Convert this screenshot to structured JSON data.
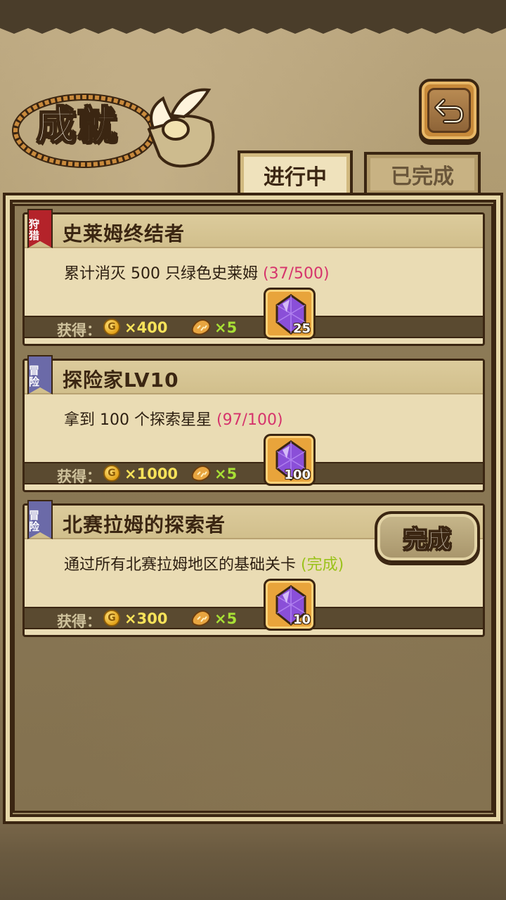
{
  "header": {
    "title": "成就",
    "back_icon": "return-arrow-icon"
  },
  "tabs": [
    {
      "label": "进行中",
      "active": true
    },
    {
      "label": "已完成",
      "active": false
    }
  ],
  "achievements": [
    {
      "tag": "狩猎",
      "tag_color": "#b4232a",
      "title": "史莱姆终结者",
      "description": "累计消灭 500 只绿色史莱姆",
      "progress": "(37/500)",
      "reward_label": "获得：",
      "gold": "×400",
      "bread": "×5",
      "gem_count": "25",
      "completed": false
    },
    {
      "tag": "冒险",
      "tag_color": "#6b6aa8",
      "title": "探险家LV10",
      "description": "拿到 100 个探索星星",
      "progress": "(97/100)",
      "reward_label": "获得：",
      "gold": "×1000",
      "bread": "×5",
      "gem_count": "100",
      "completed": false
    },
    {
      "tag": "冒险",
      "tag_color": "#6b6aa8",
      "title": "北赛拉姆的探索者",
      "description": "通过所有北赛拉姆地区的基础关卡",
      "progress": "(完成)",
      "reward_label": "获得：",
      "gold": "×300",
      "bread": "×5",
      "gem_count": "10",
      "completed": true,
      "complete_button": "完成"
    }
  ],
  "coin_symbol": "G",
  "colors": {
    "progress_in_progress": "#d6336c",
    "progress_done": "#9ac21a",
    "gold_text": "#f7e35a",
    "bread_text": "#a8e035"
  }
}
